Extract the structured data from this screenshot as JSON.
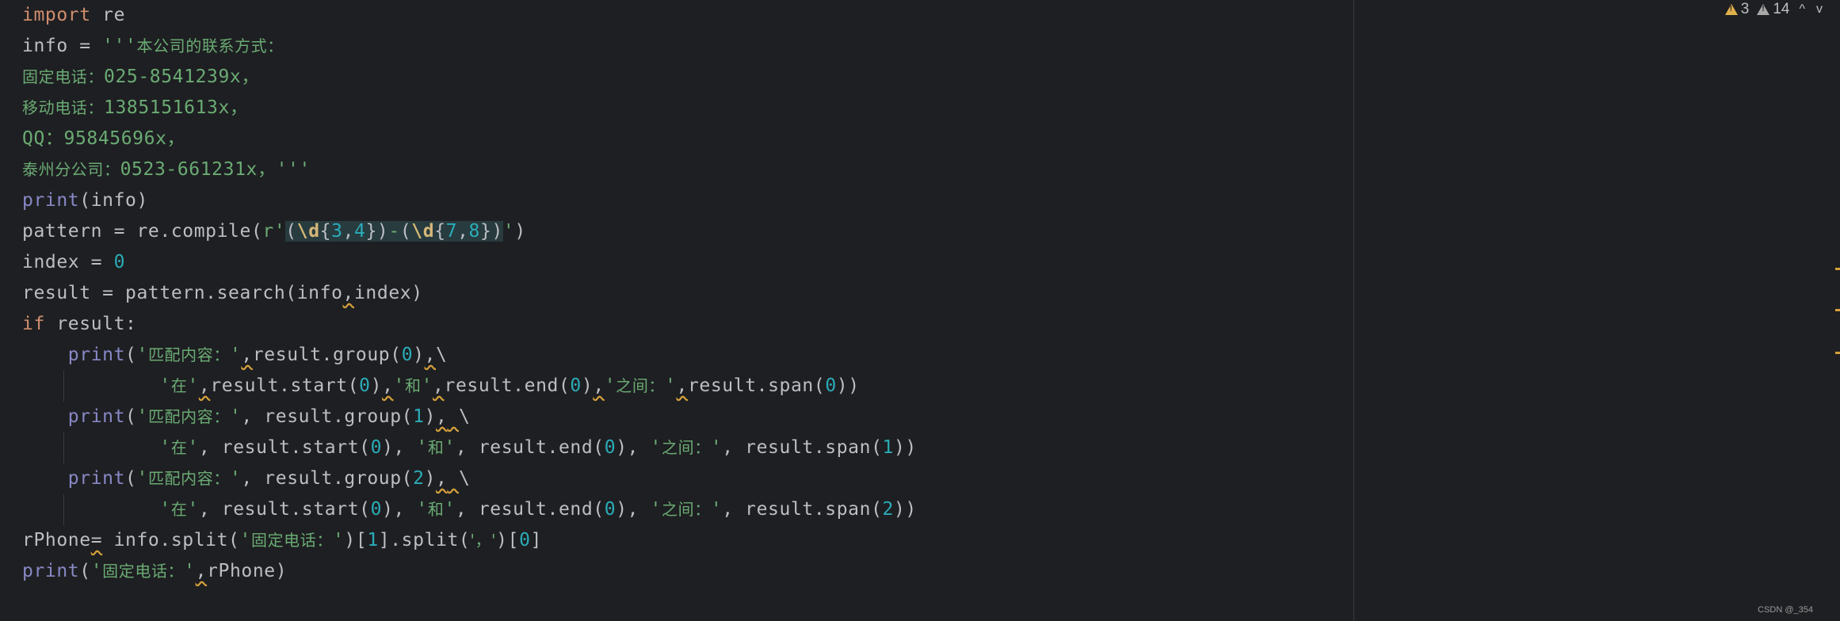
{
  "editor": {
    "lines": {
      "l1": {
        "kw": "import",
        "rest": " re"
      },
      "l2": {
        "a": "info = ",
        "q": "'''",
        "cjk": "本公司的联系方式："
      },
      "l3": {
        "cjk": "固定电话：",
        "s": "025-8541239x，"
      },
      "l4": {
        "cjk": "移动电话：",
        "s": "1385151613x，"
      },
      "l5": {
        "s": "QQ：95845696x，"
      },
      "l6": {
        "cjk": "泰州分公司：",
        "s": "0523-661231x，'''"
      },
      "l7": {
        "fn": "print",
        "rest": "(info)"
      },
      "l8": {
        "a": "pattern = re.compile(",
        "r": "r'",
        "g1o": "(",
        "d1": "\\d",
        "b1o": "{",
        "n1": "3",
        "c1": ",",
        "n2": "4",
        "b1c": "}",
        "g1c": ")",
        "dash": "-",
        "g2o": "(",
        "d2": "\\d",
        "b2o": "{",
        "n3": "7",
        "c2": ",",
        "n4": "8",
        "b2c": "}",
        "g2c": ")",
        "q": "'",
        "end": ")"
      },
      "l9": {
        "a": "index = ",
        "n": "0"
      },
      "l10": {
        "a": "result = pattern.search(info",
        "c": ",",
        "b": "index)"
      },
      "l11": {
        "kw": "if",
        "rest": " result:"
      },
      "l12": {
        "fn": "print",
        "p": "(",
        "s1": "'",
        "cjk": "匹配内容：",
        "s2": "'",
        "c1": ",",
        "a": "result.group(",
        "n": "0",
        "b": ")",
        "c2": ",",
        "bs": "\\"
      },
      "l13": {
        "s1": "'",
        "cjk1": "在",
        "s2": "'",
        "c1": ",",
        "a": "result.start(",
        "n1": "0",
        "b": ")",
        "c2": ",",
        "s3": "'",
        "cjk2": "和",
        "s4": "'",
        "c3": ",",
        "e": "result.end(",
        "n2": "0",
        "f": ")",
        "c4": ",",
        "s5": "'",
        "cjk3": "之间：",
        "s6": "'",
        "c5": ",",
        "g": "result.span(",
        "n3": "0",
        "h": "))"
      },
      "l14": {
        "fn": "print",
        "p": "(",
        "s1": "'",
        "cjk": "匹配内容：",
        "s2": "'",
        "a": ", result.group(",
        "n": "1",
        "b": ")",
        "c2": ",",
        "sp": " ",
        "bs": "\\"
      },
      "l15": {
        "s1": "'",
        "cjk1": "在",
        "s2": "'",
        "a": ", result.start(",
        "n1": "0",
        "b": "), ",
        "s3": "'",
        "cjk2": "和",
        "s4": "'",
        "e": ", result.end(",
        "n2": "0",
        "f": "), ",
        "s5": "'",
        "cjk3": "之间：",
        "s6": "'",
        "g": ", result.span(",
        "n3": "1",
        "h": "))"
      },
      "l16": {
        "fn": "print",
        "p": "(",
        "s1": "'",
        "cjk": "匹配内容：",
        "s2": "'",
        "a": ", result.group(",
        "n": "2",
        "b": ")",
        "c2": ",",
        "sp": " ",
        "bs": "\\"
      },
      "l17": {
        "s1": "'",
        "cjk1": "在",
        "s2": "'",
        "a": ", result.start(",
        "n1": "0",
        "b": "), ",
        "s3": "'",
        "cjk2": "和",
        "s4": "'",
        "e": ", result.end(",
        "n2": "0",
        "f": "), ",
        "s5": "'",
        "cjk3": "之间：",
        "s6": "'",
        "g": ", result.span(",
        "n3": "2",
        "h": "))"
      },
      "l18": {
        "a": "rPhone",
        "eq": "=",
        "b": " info.split(",
        "s1": "'",
        "cjk": "固定电话：",
        "s2": "'",
        "c": ")[",
        "n1": "1",
        "d": "].split(",
        "s3": "'，'",
        "e": ")[",
        "n2": "0",
        "f": "]"
      },
      "l19": {
        "fn": "print",
        "p": "(",
        "s1": "'",
        "cjk": "固定电话：",
        "s2": "'",
        "c": ",",
        "a": "rPhone",
        "b": ")"
      }
    }
  },
  "inspections": {
    "warnings": "3",
    "weak_warnings": "14",
    "up": "^",
    "down": "v"
  },
  "watermark": "CSDN @_354"
}
